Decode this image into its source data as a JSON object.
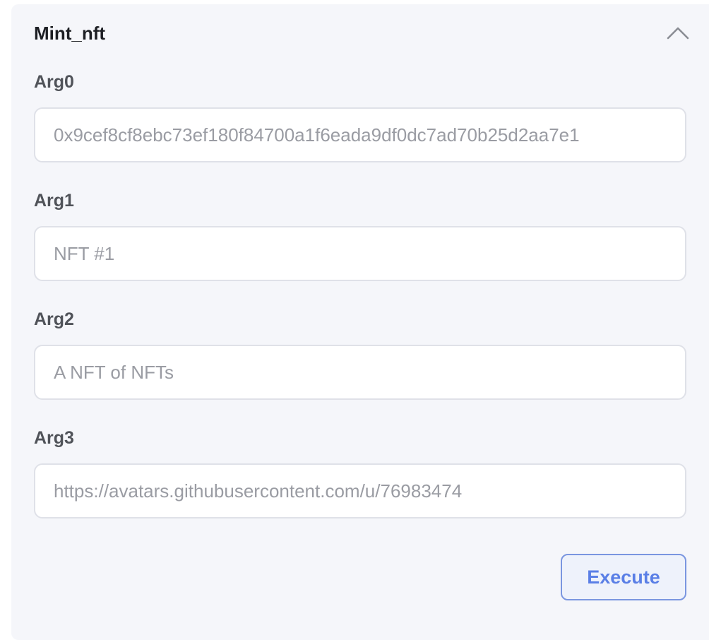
{
  "panel": {
    "title": "Mint_nft",
    "collapse_icon": "chevron-up-icon"
  },
  "args": [
    {
      "label": "Arg0",
      "placeholder": "0x9cef8cf8ebc73ef180f84700a1f6eada9df0dc7ad70b25d2aa7e1"
    },
    {
      "label": "Arg1",
      "placeholder": "NFT #1"
    },
    {
      "label": "Arg2",
      "placeholder": "A NFT of NFTs"
    },
    {
      "label": "Arg3",
      "placeholder": "https://avatars.githubusercontent.com/u/76983474"
    }
  ],
  "actions": {
    "execute_label": "Execute"
  },
  "colors": {
    "panel_bg": "#f5f6fa",
    "input_border": "#dfe1e8",
    "accent": "#5a7fe6"
  }
}
